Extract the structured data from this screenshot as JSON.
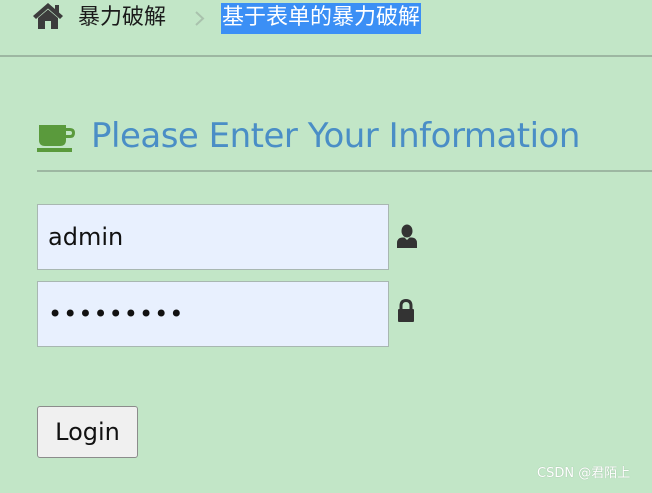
{
  "breadcrumb": {
    "home_label": "暴力破解",
    "current_label": "基于表单的暴力破解"
  },
  "form": {
    "title": "Please Enter Your Information",
    "username_value": "admin",
    "password_value": "123456789",
    "login_label": "Login"
  },
  "icons": {
    "home": "home-icon",
    "separator": "chevron-right-icon",
    "title": "coffee-cup-icon",
    "username": "user-icon",
    "password": "lock-icon"
  },
  "colors": {
    "background": "#c2e6c7",
    "title": "#4a8ec6",
    "cup": "#5a9a3c",
    "selection": "#3b8ff5",
    "input_background": "#e8f0fe"
  },
  "watermark": "CSDN @君陌上"
}
